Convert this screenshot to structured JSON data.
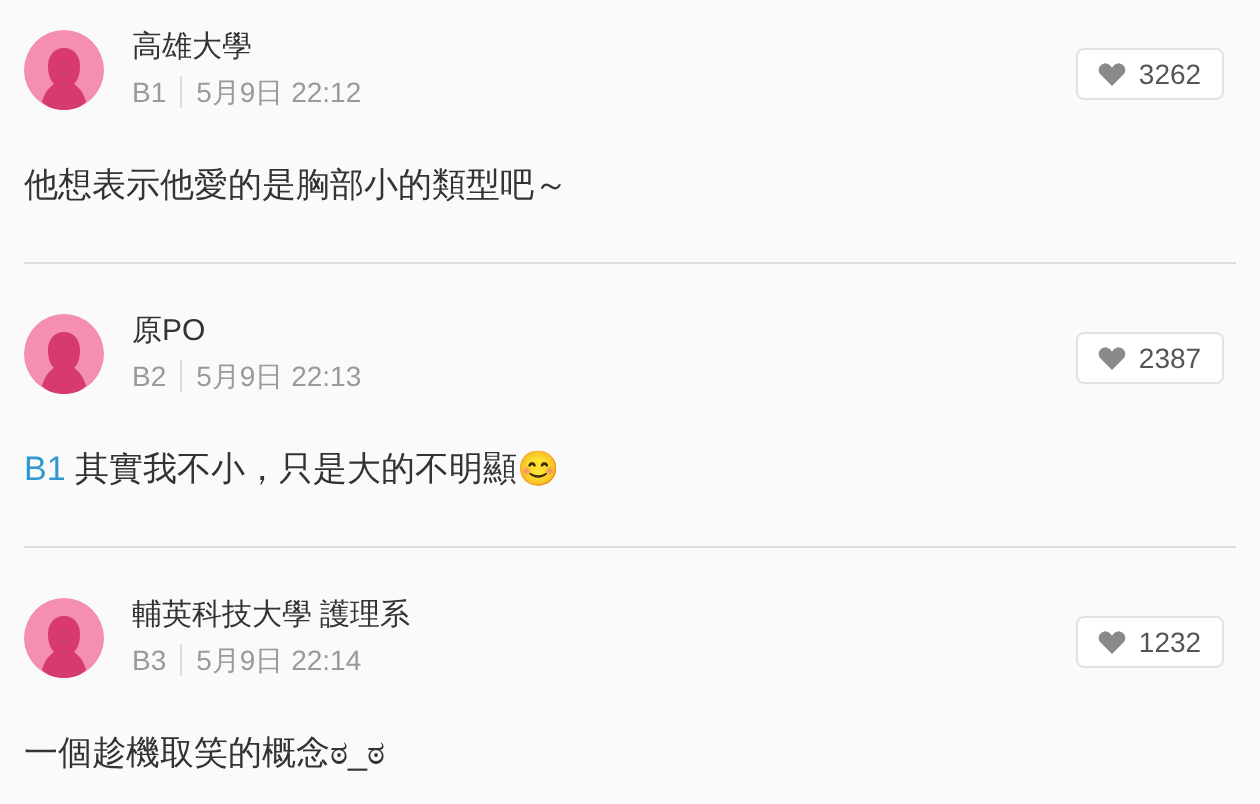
{
  "comments": [
    {
      "author": "高雄大學",
      "floor": "B1",
      "date": "5月9日 22:12",
      "likes": "3262",
      "body": [
        {
          "kind": "text",
          "text": "他想表示他愛的是胸部小的類型吧～"
        }
      ]
    },
    {
      "author": "原PO",
      "floor": "B2",
      "date": "5月9日 22:13",
      "likes": "2387",
      "body": [
        {
          "kind": "mention",
          "text": "B1"
        },
        {
          "kind": "text",
          "text": " 其實我不小，只是大的不明顯😊"
        }
      ]
    },
    {
      "author": "輔英科技大學 護理系",
      "floor": "B3",
      "date": "5月9日 22:14",
      "likes": "1232",
      "body": [
        {
          "kind": "text",
          "text": "一個趁機取笑的概念ಠ_ಠ"
        }
      ]
    }
  ]
}
